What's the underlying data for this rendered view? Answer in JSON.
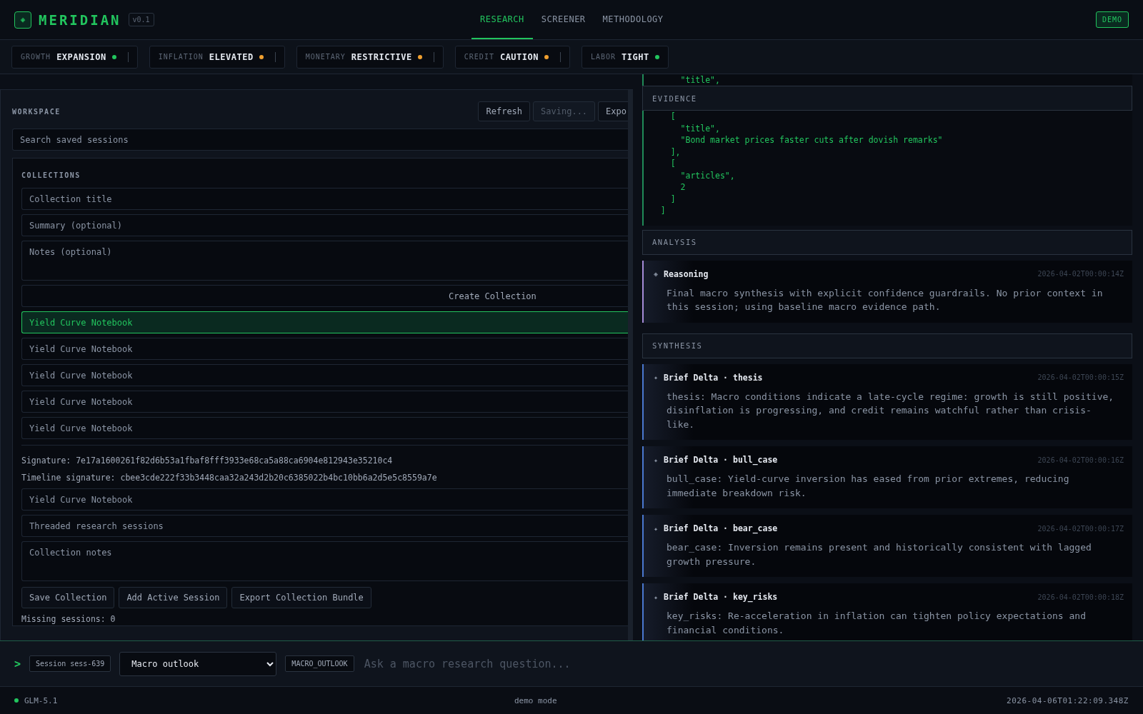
{
  "header": {
    "logo_glyph": "◈",
    "brand": "MERIDIAN",
    "version": "v0.1",
    "nav": [
      {
        "label": "RESEARCH",
        "selected": true
      },
      {
        "label": "SCREENER",
        "selected": false
      },
      {
        "label": "METHODOLOGY",
        "selected": false
      }
    ],
    "demo_button": "DEMO"
  },
  "regimes": [
    {
      "label": "GROWTH",
      "value": "EXPANSION",
      "color": "#22c55e",
      "divider": true
    },
    {
      "label": "INFLATION",
      "value": "ELEVATED",
      "color": "#f0a030",
      "divider": true
    },
    {
      "label": "MONETARY",
      "value": "RESTRICTIVE",
      "color": "#f0a030",
      "divider": true
    },
    {
      "label": "CREDIT",
      "value": "CAUTION",
      "color": "#f0a030",
      "divider": true
    },
    {
      "label": "LABOR",
      "value": "TIGHT",
      "color": "#22c55e",
      "divider": false
    }
  ],
  "workspace": {
    "title": "WORKSPACE",
    "buttons": [
      {
        "label": "Refresh",
        "disabled": false
      },
      {
        "label": "Saving...",
        "disabled": true
      },
      {
        "label": "Expo",
        "disabled": false
      }
    ],
    "search": {
      "placeholder": "Search saved sessions"
    },
    "collections": {
      "title": "COLLECTIONS",
      "new_fields": [
        {
          "kind": "input",
          "placeholder": "Collection title"
        },
        {
          "kind": "input",
          "placeholder": "Summary (optional)"
        },
        {
          "kind": "textarea",
          "placeholder": "Notes (optional)"
        }
      ],
      "create_button": "Create Collection",
      "items": [
        {
          "label": "Yield Curve Notebook",
          "selected": true
        },
        {
          "label": "Yield Curve Notebook",
          "selected": false
        },
        {
          "label": "Yield Curve Notebook",
          "selected": false
        },
        {
          "label": "Yield Curve Notebook",
          "selected": false
        },
        {
          "label": "Yield Curve Notebook",
          "selected": false
        }
      ],
      "signature": "Signature: 7e17a1600261f82d6b53a1fbaf8fff3933e68ca5a88ca6904e812943e35210c4",
      "timeline_signature": "Timeline signature: cbee3cde222f33b3448caa32a243d2b20c6385022b4bc10bb6a2d5e5c8559a7e",
      "edit_fields": [
        {
          "kind": "input",
          "value": "Yield Curve Notebook"
        },
        {
          "kind": "input",
          "value": "Threaded research sessions"
        },
        {
          "kind": "textarea",
          "value": "Collection notes"
        }
      ],
      "actions": [
        "Save Collection",
        "Add Active Session",
        "Export Collection Bundle"
      ],
      "missing": "Missing sessions: 0"
    }
  },
  "research": {
    "code_top": [
      "      \"title\","
    ],
    "sections": [
      {
        "title": "EVIDENCE",
        "kind": "code",
        "lines": [
          "    [",
          "      \"title\",",
          "      \"Bond market prices faster cuts after dovish remarks\"",
          "    ],",
          "    [",
          "      \"articles\",",
          "      2",
          "    ]",
          "  ]"
        ]
      },
      {
        "title": "ANALYSIS",
        "kind": "entries",
        "entries": [
          {
            "kind": "reasoning",
            "icon": "◈",
            "title": "Reasoning",
            "time": "2026-04-02T00:00:14Z",
            "text": "Final macro synthesis with explicit confidence guardrails. No prior context in this session; using baseline macro evidence path."
          }
        ]
      },
      {
        "title": "SYNTHESIS",
        "kind": "entries",
        "entries": [
          {
            "kind": "delta",
            "icon": "✦",
            "title": "Brief Delta · thesis",
            "time": "2026-04-02T00:00:15Z",
            "text": "thesis: Macro conditions indicate a late-cycle regime: growth is still positive, disinflation is progressing, and credit remains watchful rather than crisis-like."
          },
          {
            "kind": "delta",
            "icon": "✦",
            "title": "Brief Delta · bull_case",
            "time": "2026-04-02T00:00:16Z",
            "text": "bull_case: Yield-curve inversion has eased from prior extremes, reducing immediate breakdown risk."
          },
          {
            "kind": "delta",
            "icon": "✦",
            "title": "Brief Delta · bear_case",
            "time": "2026-04-02T00:00:17Z",
            "text": "bear_case: Inversion remains present and historically consistent with lagged growth pressure."
          },
          {
            "kind": "delta",
            "icon": "✦",
            "title": "Brief Delta · key_risks",
            "time": "2026-04-02T00:00:18Z",
            "text": "key_risks: Re-acceleration in inflation can tighten policy expectations and financial conditions."
          }
        ]
      }
    ]
  },
  "prompt": {
    "glyph": ">",
    "session": "Session sess-639",
    "mode": "Macro outlook",
    "mode_tag": "MACRO_OUTLOOK",
    "placeholder": "Ask a macro research question..."
  },
  "status_bar": {
    "model": "GLM-5.1",
    "online": true,
    "mode": "demo mode",
    "time": "2026-04-06T01:22:09.348Z"
  }
}
